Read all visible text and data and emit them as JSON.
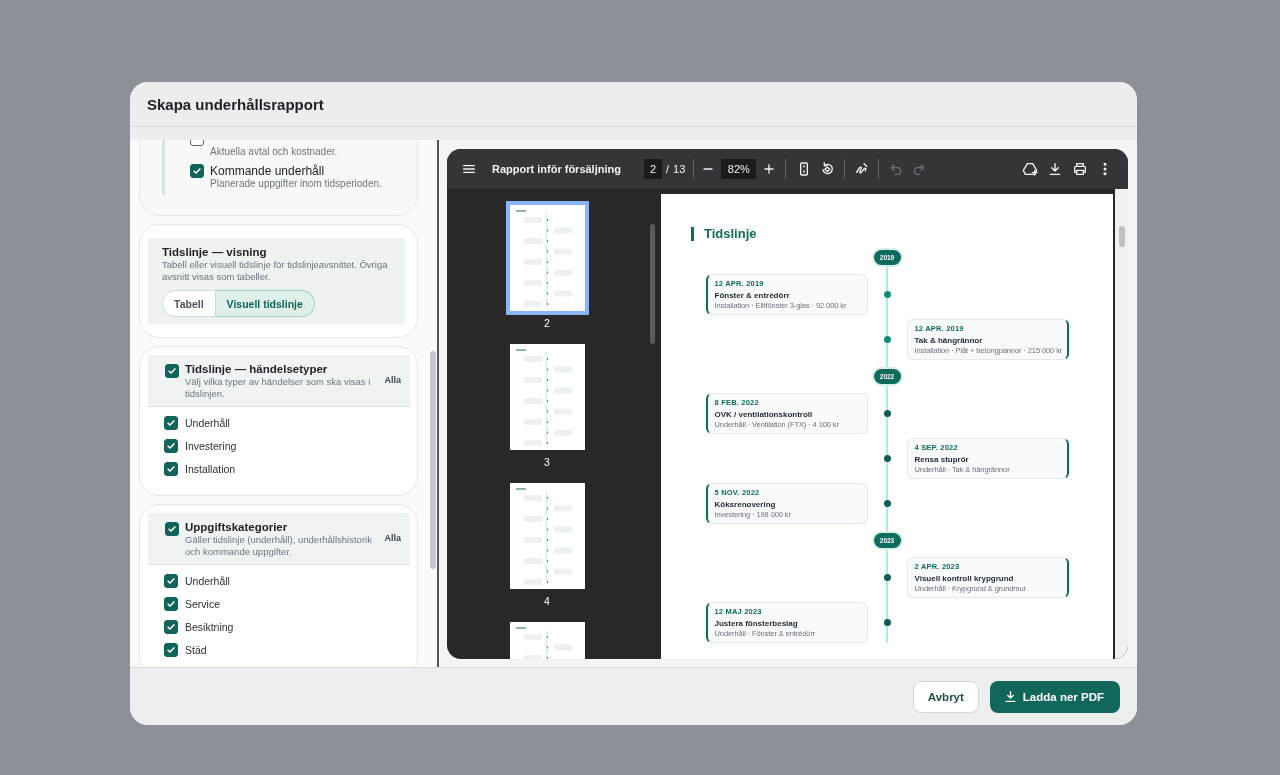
{
  "dialog": {
    "title": "Skapa underhållsrapport"
  },
  "sections": [
    {
      "kind": "options",
      "items": [
        {
          "description": "Aktuella avtal och kostnader.",
          "checked": false
        },
        {
          "label": "Kommande underhåll",
          "description": "Planerade uppgifter inom tidsperioden.",
          "checked": true
        }
      ]
    },
    {
      "kind": "segmented",
      "title": "Tidslinje — visning",
      "description": "Tabell eller visuell tidslinje för tidslinjeavsnittet. Övriga avsnitt visas som tabeller.",
      "options": [
        {
          "label": "Tabell",
          "selected": false
        },
        {
          "label": "Visuell tidslinje",
          "selected": true
        }
      ]
    },
    {
      "kind": "checklist",
      "title": "Tidslinje — händelsetyper",
      "description": "Välj vilka typer av händelser som ska visas i tidslinjen.",
      "checked": true,
      "action": "Alla",
      "items": [
        {
          "label": "Underhåll",
          "checked": true
        },
        {
          "label": "Investering",
          "checked": true
        },
        {
          "label": "Installation",
          "checked": true
        }
      ]
    },
    {
      "kind": "checklist",
      "title": "Uppgiftskategorier",
      "description": "Gäller tidslinje (underhåll), underhållshistorik och kommande uppgifter.",
      "checked": true,
      "action": "Alla",
      "items": [
        {
          "label": "Underhåll",
          "checked": true
        },
        {
          "label": "Service",
          "checked": true
        },
        {
          "label": "Besiktning",
          "checked": true
        },
        {
          "label": "Städ",
          "checked": true
        }
      ]
    }
  ],
  "pdf_viewer": {
    "title": "Rapport inför försäljning",
    "page": "2",
    "page_separator": "/",
    "page_total": "13",
    "zoom": "82%",
    "history_buttons": [
      {
        "kind": "undo",
        "disabled": true
      },
      {
        "kind": "redo",
        "disabled": true
      }
    ],
    "thumbnails": [
      {
        "label": "2",
        "selected": true
      },
      {
        "label": "3",
        "selected": false
      },
      {
        "label": "4",
        "selected": false
      },
      {
        "selected": false
      }
    ],
    "document": {
      "heading": "Tidslinje",
      "timeline": [
        {
          "kind": "year",
          "label": "2019"
        },
        {
          "kind": "left",
          "date": "12 APR. 2019",
          "title": "Fönster & entrédörr",
          "meta": "Installation · Elitfönster 3-glas · 92 000 kr",
          "color": "#138a7b"
        },
        {
          "kind": "right",
          "date": "12 APR. 2019",
          "title": "Tak & hängrännor",
          "meta": "Installation · Plåt + betongpannor · 215 000 kr",
          "color": "#138a7b"
        },
        {
          "kind": "year",
          "label": "2022"
        },
        {
          "kind": "left",
          "date": "8 FEB. 2022",
          "title": "OVK / ventilationskontroll",
          "meta": "Underhåll · Ventilation (FTX) · 4 100 kr",
          "color": "#0f5c52"
        },
        {
          "kind": "right",
          "date": "4 SEP. 2022",
          "title": "Rensa stuprör",
          "meta": "Underhåll · Tak & hängrännor",
          "color": "#0f5c52"
        },
        {
          "kind": "left",
          "date": "5 NOV. 2022",
          "title": "Köksrenovering",
          "meta": "Investering · 198 000 kr",
          "color": "#0f5c52"
        },
        {
          "kind": "year",
          "label": "2023"
        },
        {
          "kind": "right",
          "date": "2 APR. 2023",
          "title": "Visuell kontroll krypgrund",
          "meta": "Underhåll · Krypgrund & grundmur",
          "color": "#0f5c52"
        },
        {
          "kind": "left",
          "date": "12 MAJ 2023",
          "title": "Justera fönsterbeslag",
          "meta": "Underhåll · Fönster & entrédörr",
          "color": "#0f5c52"
        }
      ]
    }
  },
  "footer": {
    "buttons": [
      {
        "kind": "secondary",
        "label": "Avbryt"
      },
      {
        "kind": "primary",
        "label": "Ladda ner PDF"
      }
    ]
  }
}
